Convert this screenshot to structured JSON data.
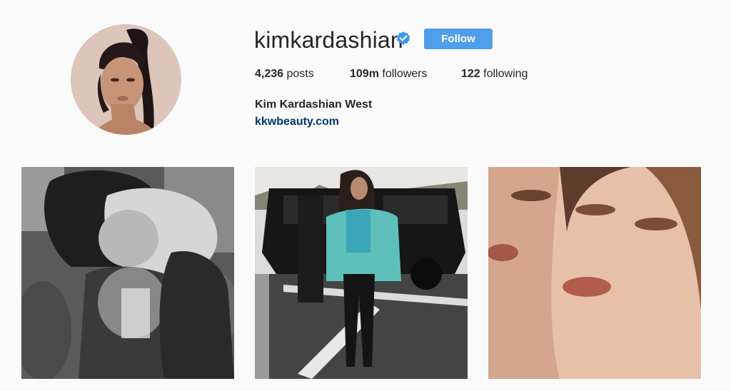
{
  "profile": {
    "username": "kimkardashian",
    "verified_icon": "verified-badge-icon",
    "follow_label": "Follow",
    "full_name": "Kim Kardashian West",
    "website": "kkwbeauty.com"
  },
  "stats": {
    "posts_count": "4,236",
    "posts_label": "posts",
    "followers_count": "109m",
    "followers_label": "followers",
    "following_count": "122",
    "following_label": "following"
  },
  "colors": {
    "follow_button": "#4e9ee9",
    "verified_badge": "#3897f0",
    "website_link": "#003569"
  },
  "posts": [
    {
      "description": "black-and-white photo"
    },
    {
      "description": "street photo"
    },
    {
      "description": "beauty close-up"
    }
  ]
}
